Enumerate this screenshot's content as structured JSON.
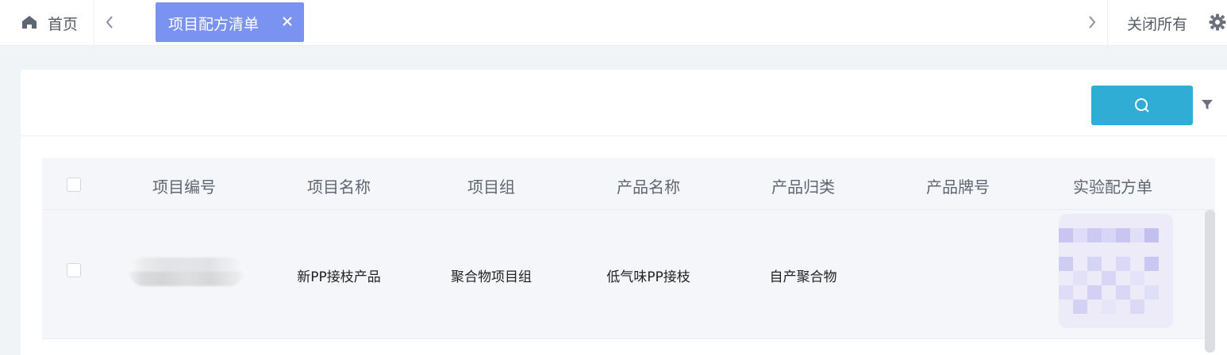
{
  "tabbar": {
    "home_label": "首页",
    "home_icon": "home-icon",
    "active_tab_label": "项目配方清单",
    "close_all_label": "关闭所有",
    "accent": "#7b93f0"
  },
  "toolbar": {
    "search_icon": "search-icon",
    "filter_icon": "filter-icon",
    "search_color": "#2fadd4"
  },
  "table": {
    "columns": [
      "项目编号",
      "项目名称",
      "项目组",
      "产品名称",
      "产品归类",
      "产品牌号",
      "实验配方单"
    ],
    "rows": [
      {
        "project_name": "新PP接枝产品",
        "project_group": "聚合物项目组",
        "product_name": "低气味PP接枝",
        "product_category": "自产聚合物",
        "product_grade": ""
      }
    ]
  }
}
